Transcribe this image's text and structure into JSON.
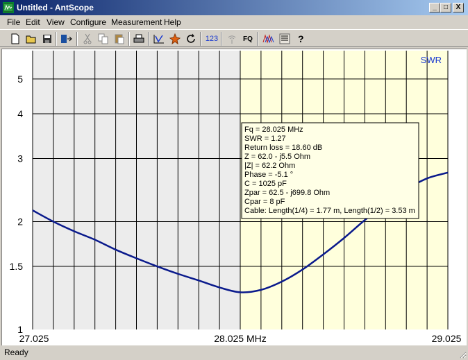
{
  "window": {
    "title": "Untitled - AntScope"
  },
  "window_buttons": {
    "minimize": "_",
    "maximize": "□",
    "close": "X"
  },
  "menu": [
    "File",
    "Edit",
    "View",
    "Configure",
    "Measurement",
    "Help"
  ],
  "toolbar": {
    "icons": [
      "new-icon",
      "open-icon",
      "save-icon",
      "export-icon",
      "cut-icon",
      "copy-icon",
      "paste-icon",
      "print-icon",
      "scan-icon",
      "stop-icon",
      "refresh-icon",
      "numeric-readout-icon",
      "wireless-icon",
      "frequency-icon",
      "markers-icon",
      "display-mode-icon",
      "help-icon"
    ],
    "numeric_label": "123",
    "fq_label": "FQ"
  },
  "chart_data": {
    "type": "line",
    "series": [
      {
        "name": "SWR",
        "color": "#0a1a8c",
        "x": [
          27.025,
          27.125,
          27.225,
          27.325,
          27.425,
          27.525,
          27.625,
          27.725,
          27.825,
          27.925,
          28.025,
          28.125,
          28.225,
          28.325,
          28.425,
          28.525,
          28.625,
          28.725,
          28.825,
          28.925,
          29.025
        ],
        "y": [
          2.15,
          2.0,
          1.88,
          1.78,
          1.67,
          1.58,
          1.5,
          1.43,
          1.37,
          1.31,
          1.27,
          1.29,
          1.36,
          1.47,
          1.62,
          1.8,
          2.02,
          2.24,
          2.46,
          2.64,
          2.74
        ]
      }
    ],
    "x_ticks": [
      "27.025",
      "28.025 MHz",
      "29.025"
    ],
    "y_ticks": [
      "1",
      "1.5",
      "2",
      "3",
      "4",
      "5"
    ],
    "xlim": [
      27.025,
      29.025
    ],
    "ylim": [
      1,
      6
    ],
    "grid": true,
    "legend": "SWR",
    "shaded_band_mhz": [
      27.025,
      28.025
    ],
    "highlight_band_mhz": [
      28.025,
      29.025
    ],
    "shaded_color": "#ececec",
    "highlight_color": "#ffffdc"
  },
  "readout": {
    "lines": [
      "Fq = 28.025 MHz",
      "SWR = 1.27",
      "Return loss = 18.60 dB",
      "Z = 62.0 - j5.5 Ohm",
      "|Z| = 62.2 Ohm",
      "Phase = -5.1 °",
      "C = 1025 pF",
      "Zpar = 62.5 - j699.8 Ohm",
      "Cpar = 8 pF",
      "Cable: Length(1/4) = 1.77 m, Length(1/2) = 3.53 m"
    ]
  },
  "status": {
    "text": "Ready"
  }
}
